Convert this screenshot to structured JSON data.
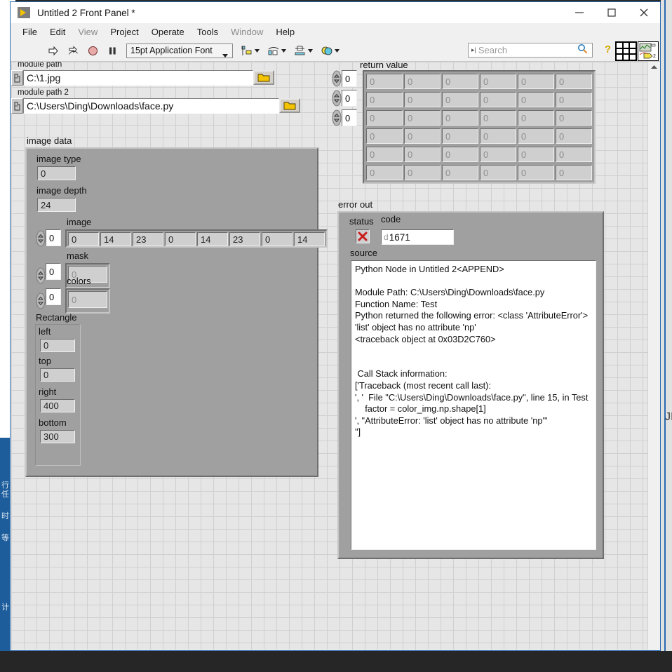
{
  "window": {
    "title": "Untitled 2 Front Panel *",
    "logo_icon": "labview-run-arrow-icon",
    "minimize_label": "minimize-icon",
    "maximize_label": "maximize-icon",
    "close_label": "close-icon"
  },
  "menubar": {
    "items": [
      {
        "label": "File",
        "dim": false
      },
      {
        "label": "Edit",
        "dim": false
      },
      {
        "label": "View",
        "dim": true
      },
      {
        "label": "Project",
        "dim": false
      },
      {
        "label": "Operate",
        "dim": false
      },
      {
        "label": "Tools",
        "dim": false
      },
      {
        "label": "Window",
        "dim": true
      },
      {
        "label": "Help",
        "dim": false
      }
    ]
  },
  "toolbar": {
    "run_icon": "run-arrow-icon",
    "run_continuously_icon": "run-continuously-icon",
    "abort_icon": "abort-execution-icon",
    "pause_icon": "pause-icon",
    "font_selector": "15pt Application Font",
    "align_icon": "align-objects-icon",
    "distribute_icon": "distribute-objects-icon",
    "resize_icon": "resize-objects-icon",
    "reorder_icon": "reorder-objects-icon",
    "search_placeholder": "Search",
    "search_icon": "magnifier-icon",
    "help_icon": "context-help-icon",
    "connector_pane_icon": "connector-pane-icon",
    "vi_icon": "vi-icon",
    "vi_icon_badge": "2"
  },
  "front_panel": {
    "module_path": {
      "label": "module path",
      "value": "C:\\1.jpg",
      "browse_icon": "folder-browse-icon",
      "path_type_icon": "path-glyph-icon"
    },
    "module_path_2": {
      "label": "module path 2",
      "value": "C:\\Users\\Ding\\Downloads\\face.py",
      "browse_icon": "folder-browse-icon",
      "path_type_icon": "path-glyph-icon"
    },
    "image_data": {
      "label": "image data",
      "image_type": {
        "label": "image type",
        "value": "0"
      },
      "image_depth": {
        "label": "image depth",
        "value": "24"
      },
      "image_array": {
        "label": "image",
        "index": "0",
        "values": [
          "0",
          "14",
          "23",
          "0",
          "14",
          "23",
          "0",
          "14"
        ]
      },
      "mask_array": {
        "label": "mask",
        "index": "0",
        "values": [
          "0"
        ]
      },
      "colors_array": {
        "label": "colors",
        "index": "0",
        "values": [
          "0"
        ]
      },
      "rectangle": {
        "label": "Rectangle",
        "fields": [
          {
            "label": "left",
            "value": "0"
          },
          {
            "label": "top",
            "value": "0"
          },
          {
            "label": "right",
            "value": "400"
          },
          {
            "label": "bottom",
            "value": "300"
          }
        ]
      }
    },
    "return_value": {
      "label": "return value",
      "indices": [
        "0",
        "0",
        "0"
      ],
      "rows": [
        [
          "0",
          "0",
          "0",
          "0",
          "0",
          "0"
        ],
        [
          "0",
          "0",
          "0",
          "0",
          "0",
          "0"
        ],
        [
          "0",
          "0",
          "0",
          "0",
          "0",
          "0"
        ],
        [
          "0",
          "0",
          "0",
          "0",
          "0",
          "0"
        ],
        [
          "0",
          "0",
          "0",
          "0",
          "0",
          "0"
        ],
        [
          "0",
          "0",
          "0",
          "0",
          "0",
          "0"
        ]
      ]
    },
    "error_out": {
      "label": "error out",
      "status_label": "status",
      "status_icon": "error-x-icon",
      "code_label": "code",
      "code_radix": "d",
      "code_value": "1671",
      "source_label": "source",
      "source_text": "Python Node in Untitled 2<APPEND>\n\nModule Path: C:\\Users\\Ding\\Downloads\\face.py\nFunction Name: Test\nPython returned the following error: <class 'AttributeError'>\n'list' object has no attribute 'np'\n<traceback object at 0x03D2C760>\n\n\n Call Stack information:\n['Traceback (most recent call last):\n', '  File \"C:\\Users\\Ding\\Downloads\\face.py\", line 15, in Test\n    factor = color_img.np.shape[1]\n', \"AttributeError: 'list' object has no attribute 'np'\"\n\"]"
    },
    "scroll_up_icon": "scroll-up-arrow-icon"
  },
  "background": {
    "left_strip_lines": [
      "行任",
      "时",
      "等",
      "",
      "",
      "计"
    ],
    "right_ghost_text": "JI"
  },
  "colors": {
    "accent_blue": "#2a6ab0",
    "panel_grey": "#a0a0a0",
    "canvas_grey": "#e6e6e6",
    "error_red": "#cc2222",
    "taskbar": "#262626"
  }
}
